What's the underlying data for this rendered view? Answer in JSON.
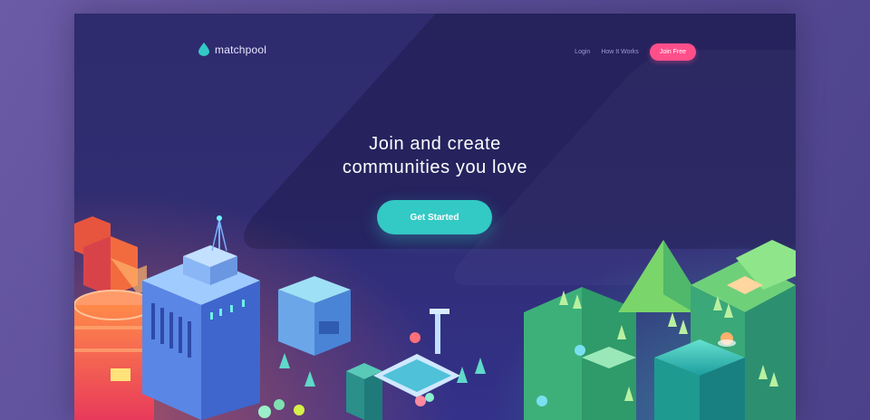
{
  "brand": {
    "name": "matchpool",
    "accent": "#33c9c4",
    "pink": "#ff4f8b"
  },
  "nav": {
    "login": "Login",
    "how_it_works": "How It Works",
    "join_free": "Join Free"
  },
  "hero": {
    "line1": "Join and create",
    "line2": "communities you love",
    "cta": "Get Started"
  },
  "icons": {
    "logo": "water-drop-icon"
  }
}
